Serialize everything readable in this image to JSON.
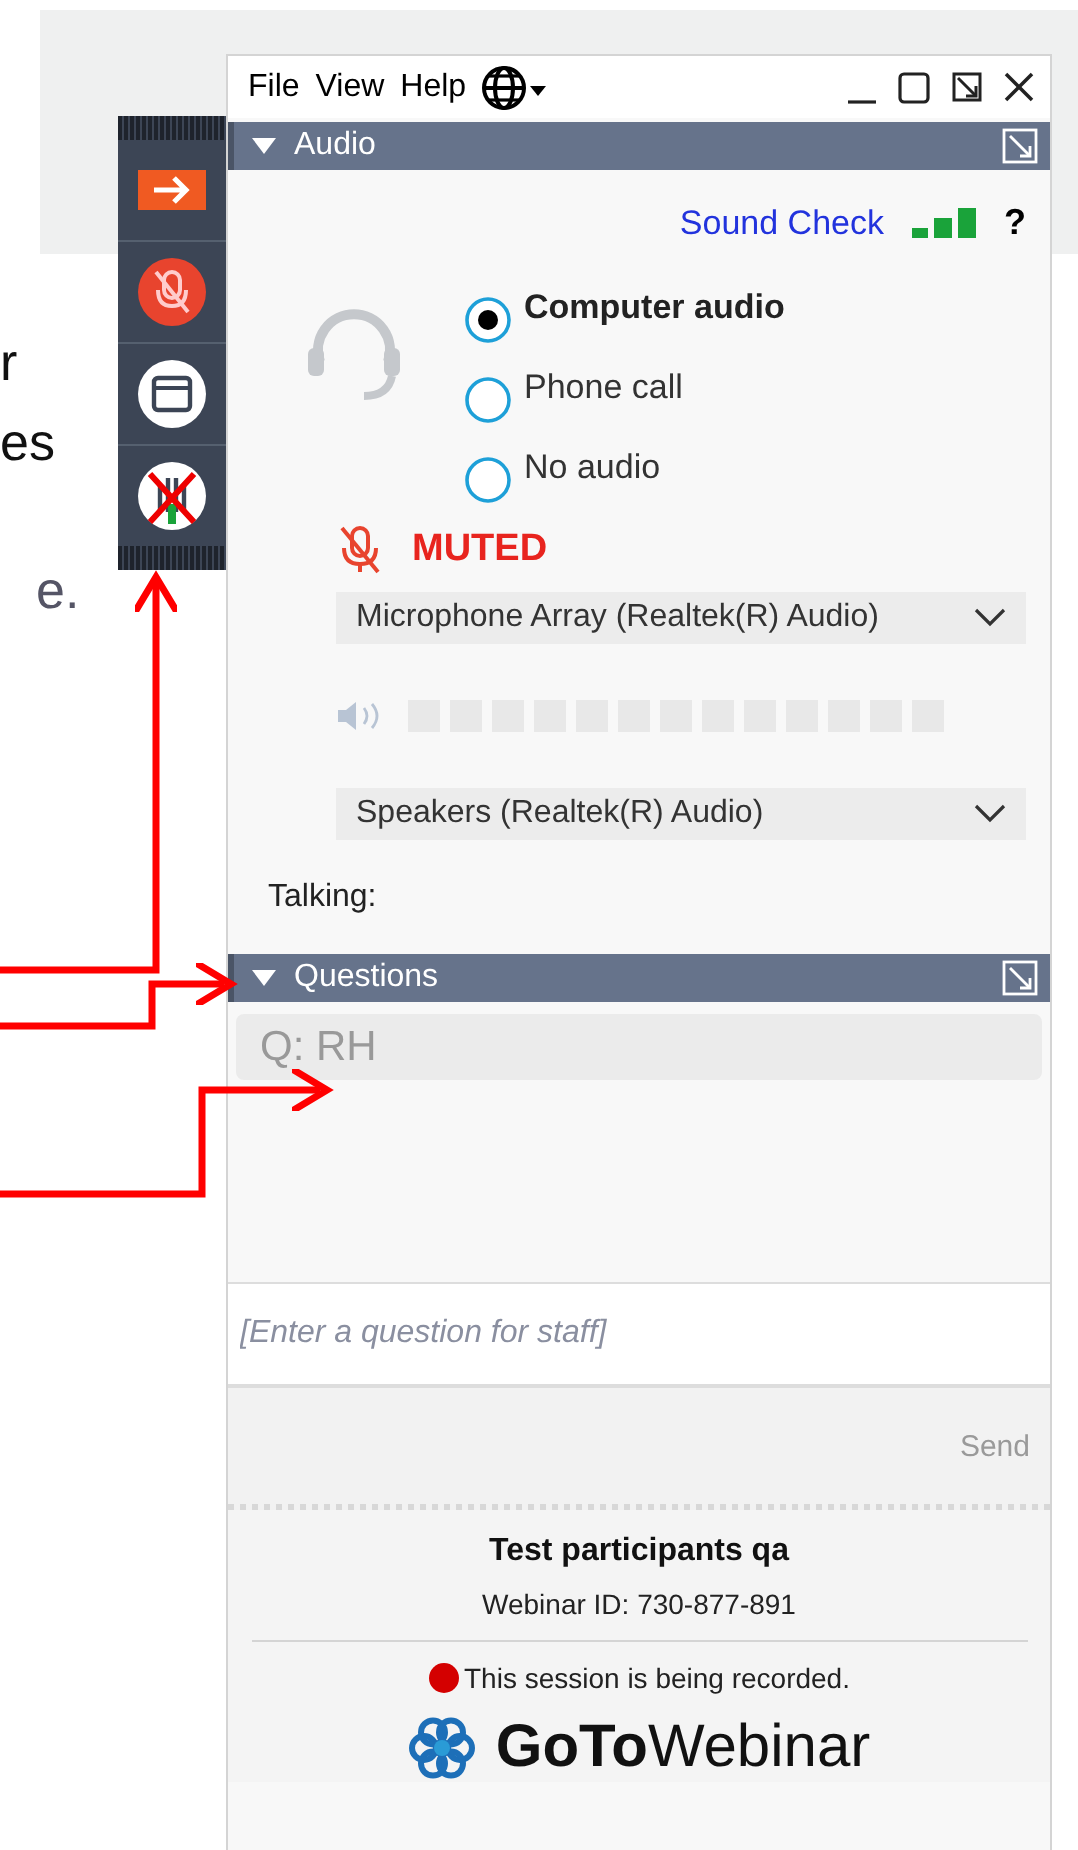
{
  "background_text": [
    "r",
    "es",
    "e."
  ],
  "window": {
    "menu": [
      "File",
      "View",
      "Help"
    ],
    "controls": [
      {
        "kind": "minimize"
      },
      {
        "kind": "maximize"
      },
      {
        "kind": "popout"
      },
      {
        "kind": "close"
      }
    ]
  },
  "toolbar": [
    {
      "kind": "arrow"
    },
    {
      "kind": "mic",
      "muted": true
    },
    {
      "kind": "window"
    },
    {
      "kind": "hand"
    }
  ],
  "audio": {
    "title": "Audio",
    "expanded": true,
    "sound_check": "Sound Check",
    "help": "?",
    "options": [
      {
        "label": "Computer audio",
        "selected": true
      },
      {
        "label": "Phone call",
        "selected": false
      },
      {
        "label": "No audio",
        "selected": false
      }
    ],
    "mic_status": "MUTED",
    "microphone": "Microphone Array (Realtek(R) Audio)",
    "speaker_meter": {
      "level": 0
    },
    "speakers": "Speakers (Realtek(R) Audio)",
    "talking": "Talking:"
  },
  "questions": {
    "title": "Questions",
    "expanded": true,
    "items": [
      "Q: RH"
    ],
    "input": {
      "placeholder": "[Enter a question for staff]"
    },
    "send": {
      "label": "Send",
      "disabled": true
    }
  },
  "footer": {
    "title": "Test participants qa",
    "webinar_id": "Webinar ID: 730-877-891",
    "recording": "This session is being recorded.",
    "logo": "**GoTo**Webinar"
  }
}
